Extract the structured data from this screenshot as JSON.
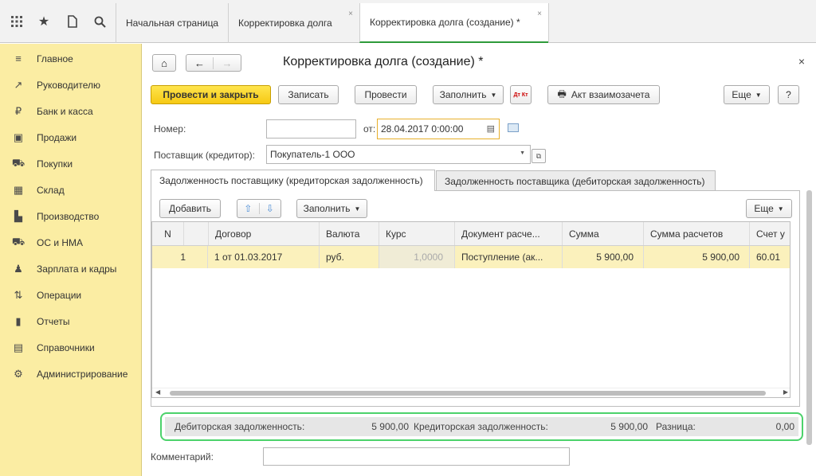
{
  "top_tabs": [
    {
      "label": "Начальная страница"
    },
    {
      "label": "Корректировка долга"
    },
    {
      "label": "Корректировка долга (создание) *"
    }
  ],
  "tab_close_glyph": "×",
  "sidebar": {
    "items": [
      {
        "label": "Главное",
        "icon": "≡"
      },
      {
        "label": "Руководителю",
        "icon": "↗"
      },
      {
        "label": "Банк и касса",
        "icon": "₽"
      },
      {
        "label": "Продажи",
        "icon": "▣"
      },
      {
        "label": "Покупки",
        "icon": "⛟"
      },
      {
        "label": "Склад",
        "icon": "▦"
      },
      {
        "label": "Производство",
        "icon": "▙"
      },
      {
        "label": "ОС и НМА",
        "icon": "⛟"
      },
      {
        "label": "Зарплата и кадры",
        "icon": "♟"
      },
      {
        "label": "Операции",
        "icon": "⇅"
      },
      {
        "label": "Отчеты",
        "icon": "▮"
      },
      {
        "label": "Справочники",
        "icon": "▤"
      },
      {
        "label": "Администрирование",
        "icon": "⚙"
      }
    ]
  },
  "header": {
    "title": "Корректировка долга (создание) *",
    "close": "×"
  },
  "toolbar": {
    "post_close": "Провести и закрыть",
    "save": "Записать",
    "post": "Провести",
    "fill": "Заполнить",
    "dt_kt": "Дт Кт",
    "offset_act": "Акт взаимозачета",
    "more": "Еще",
    "help": "?"
  },
  "form": {
    "number_label": "Номер:",
    "number_value": "",
    "date_label": "от:",
    "date_value": "28.04.2017  0:00:00",
    "supplier_label": "Поставщик (кредитор):",
    "supplier_value": "Покупатель-1 ООО"
  },
  "form_tabs": [
    {
      "label": "Задолженность поставщику (кредиторская задолженность)"
    },
    {
      "label": "Задолженность поставщика (дебиторская задолженность)"
    }
  ],
  "table_toolbar": {
    "add": "Добавить",
    "fill": "Заполнить",
    "more": "Еще"
  },
  "table": {
    "columns": [
      "N",
      "Договор",
      "Валюта",
      "Курс",
      "Документ расче...",
      "Сумма",
      "Сумма расчетов",
      "Счет у"
    ],
    "rows": [
      [
        "1",
        "1 от 01.03.2017",
        "руб.",
        "1,0000",
        "Поступление (ак...",
        "5 900,00",
        "5 900,00",
        "60.01"
      ]
    ]
  },
  "totals": {
    "debit_label": "Дебиторская задолженность:",
    "debit_value": "5 900,00",
    "credit_label": "Кредиторская задолженность:",
    "credit_value": "5 900,00",
    "diff_label": "Разница:",
    "diff_value": "0,00"
  },
  "comment": {
    "label": "Комментарий:",
    "value": ""
  }
}
